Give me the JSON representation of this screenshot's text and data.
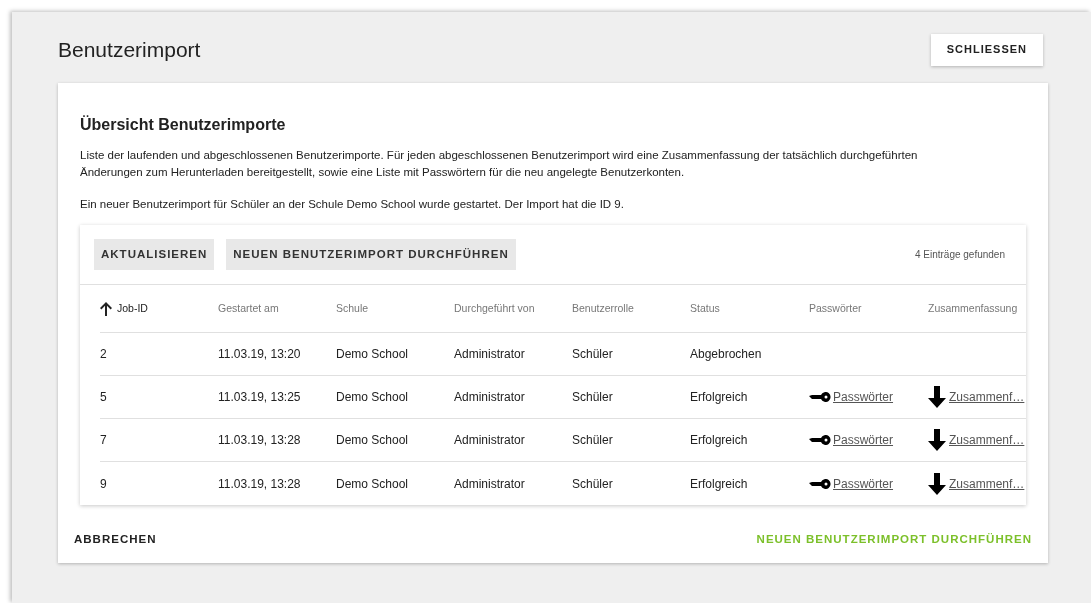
{
  "header": {
    "title": "Benutzerimport",
    "close_button": "SCHLIESSEN"
  },
  "card": {
    "heading": "Übersicht Benutzerimporte",
    "description": "Liste der laufenden und abgeschlossenen Benutzerimporte. Für jeden abgeschlossenen Benutzerimport wird eine Zusammenfassung der tatsächlich durchgeführten Änderungen zum Herunterladen bereitgestellt, sowie eine Liste mit Passwörtern für die neu angelegte Benutzerkonten.",
    "notice": "Ein neuer Benutzerimport für Schüler an der Schule Demo School wurde gestartet. Der Import hat die ID 9."
  },
  "toolbar": {
    "buttons": [
      "AKTUALISIEREN",
      "NEUEN BENUTZERIMPORT DURCHFÜHREN"
    ],
    "count": "4 Einträge gefunden"
  },
  "table": {
    "columns": [
      {
        "label": "Job-ID",
        "sorted": true
      },
      {
        "label": "Gestartet am",
        "sorted": false
      },
      {
        "label": "Schule",
        "sorted": false
      },
      {
        "label": "Durchgeführt von",
        "sorted": false
      },
      {
        "label": "Benutzerrolle",
        "sorted": false
      },
      {
        "label": "Status",
        "sorted": false
      },
      {
        "label": "Passwörter",
        "sorted": false
      },
      {
        "label": "Zusammenfassung",
        "sorted": false
      }
    ],
    "rows": [
      {
        "cells": [
          "2",
          "11.03.19, 13:20",
          "Demo School",
          "Administrator",
          "Schüler",
          "Abgebrochen"
        ]
      },
      {
        "cells": [
          "5",
          "11.03.19, 13:25",
          "Demo School",
          "Administrator",
          "Schüler",
          "Erfolgreich"
        ],
        "passwords": "Passwörter",
        "summary": "Zusammenf…"
      },
      {
        "cells": [
          "7",
          "11.03.19, 13:28",
          "Demo School",
          "Administrator",
          "Schüler",
          "Erfolgreich"
        ],
        "passwords": "Passwörter",
        "summary": "Zusammenf…"
      },
      {
        "cells": [
          "9",
          "11.03.19, 13:28",
          "Demo School",
          "Administrator",
          "Schüler",
          "Erfolgreich"
        ],
        "passwords": "Passwörter",
        "summary": "Zusammenf…"
      }
    ]
  },
  "footer": {
    "cancel": "ABBRECHEN",
    "confirm": "NEUEN BENUTZERIMPORT DURCHFÜHREN"
  }
}
